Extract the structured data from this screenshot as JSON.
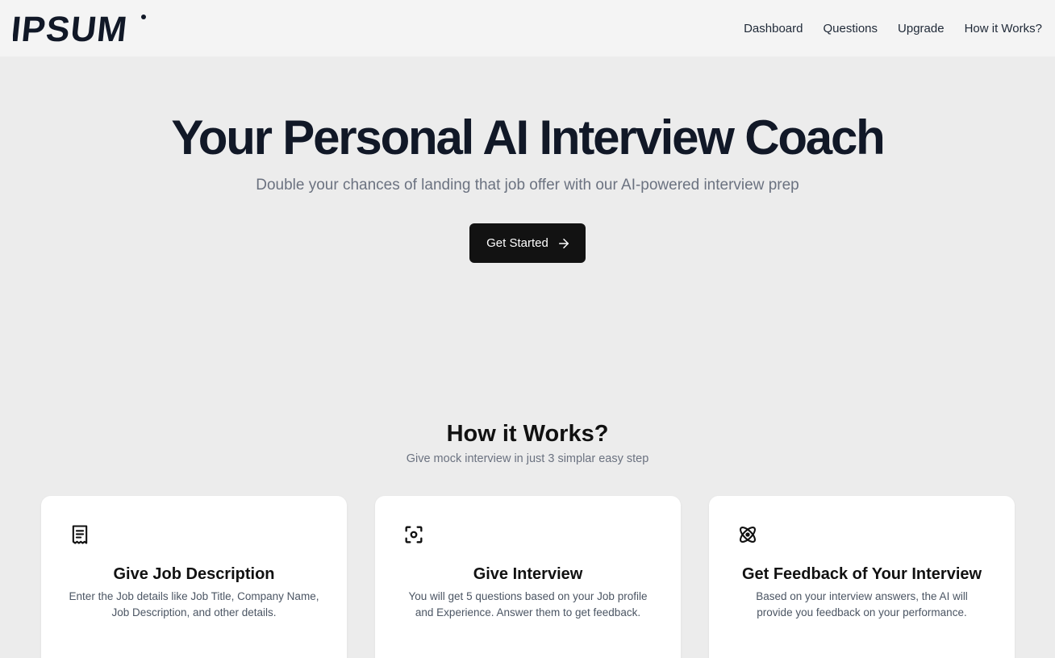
{
  "brand": {
    "logo_text": "IPSUM"
  },
  "nav": {
    "items": [
      {
        "label": "Dashboard"
      },
      {
        "label": "Questions"
      },
      {
        "label": "Upgrade"
      },
      {
        "label": "How it Works?"
      }
    ]
  },
  "hero": {
    "title": "Your Personal AI Interview Coach",
    "subtitle": "Double your chances of landing that job offer with our AI-powered interview prep",
    "cta_label": "Get Started",
    "cta_icon": "arrow-right-icon"
  },
  "how": {
    "title": "How it Works?",
    "subtitle": "Give mock interview in just 3 simplar easy step",
    "steps": [
      {
        "icon": "document-icon",
        "title": "Give Job Description",
        "description": "Enter the Job details like Job Title, Company Name, Job Description, and other details."
      },
      {
        "icon": "scan-icon",
        "title": "Give Interview",
        "description": "You will get 5 questions based on your Job profile and Experience. Answer them to get feedback."
      },
      {
        "icon": "atom-icon",
        "title": "Get Feedback of Your Interview",
        "description": "Based on your interview answers, the AI will provide you feedback on your performance."
      }
    ]
  },
  "colors": {
    "page_background": "#ececec",
    "header_background": "#f4f4f4",
    "cta_background": "#121212",
    "heading": "#111827",
    "muted_text": "#6b7280",
    "card_background": "#ffffff"
  }
}
